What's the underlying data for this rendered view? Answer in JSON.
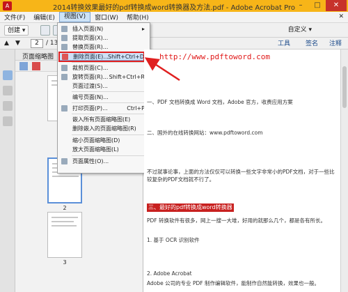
{
  "window": {
    "title": "2014转换效果最好的pdf转换成word转换器及方法.pdf - Adobe Acrobat Pro",
    "app_icon": "acrobat-icon"
  },
  "menubar": {
    "items": [
      "文件(F)",
      "编辑(E)",
      "视图(V)",
      "窗口(W)",
      "帮助(H)"
    ]
  },
  "toolbar": {
    "create_label": "创建",
    "page_current": "2",
    "page_total": "/ 13",
    "customize_label": "自定义",
    "tabs": [
      "工具",
      "签名",
      "注释"
    ]
  },
  "panel": {
    "title": "页面缩略图",
    "page_labels": [
      "2",
      "3"
    ]
  },
  "context_menu": {
    "items": [
      {
        "label": "插入页面(N)",
        "shortcut": ""
      },
      {
        "label": "提取页面(X)...",
        "shortcut": ""
      },
      {
        "label": "替换页面(R)...",
        "shortcut": ""
      },
      {
        "label": "删除页面(E)...",
        "shortcut": "Shift+Ctrl+D"
      },
      {
        "label": "裁剪页面(C)...",
        "shortcut": ""
      },
      {
        "label": "旋转页面(R)...",
        "shortcut": "Shift+Ctrl+R"
      },
      {
        "label": "页面过渡(S)...",
        "shortcut": ""
      },
      {
        "label": "编号页面(N)...",
        "shortcut": ""
      },
      {
        "label": "打印页面(P)...",
        "shortcut": "Ctrl+P"
      },
      {
        "label": "嵌入所有页面缩略图(E)",
        "shortcut": ""
      },
      {
        "label": "删除嵌入的页面缩略图(R)",
        "shortcut": ""
      },
      {
        "label": "缩小页面缩略图(D)",
        "shortcut": ""
      },
      {
        "label": "放大页面缩略图(L)",
        "shortcut": ""
      },
      {
        "label": "页面属性(O)...",
        "shortcut": ""
      }
    ],
    "highlighted": "删除页面(E)..."
  },
  "document": {
    "url": "http://www.pdftoword.com",
    "para1": "一、PDF 文档转换成 Word 文档，Adobe 官方，收费应用方案",
    "para2": "二、国外的在线转换网站：www.pdftoword.com",
    "para3": "不过就事论事，上面的方法仅仅可以转换一些文字非常小的PDF文档，对于一些比较复杂的PDF文档就不行了。",
    "section_header": "三、最好的pdf转换成word转换器",
    "para4": "PDF 转换软件有很多，网上一搜一大堆，好用的就那么几个，都是各有所长。",
    "item1": "1. 基于 OCR 识别软件",
    "item2": "2. Adobe Acrobat",
    "item2_desc": "Adobe 公司的专业 PDF 制作编辑软件，能制作自然能转换，效果也一般。"
  },
  "colors": {
    "titlebar": "#f7b518",
    "highlight_box": "#e02020",
    "menu_highlight": "#cfe0f6",
    "url_text": "#e01818"
  }
}
